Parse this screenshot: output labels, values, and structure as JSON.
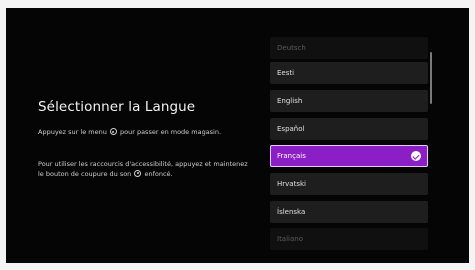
{
  "heading": "Sélectionner la Langue",
  "instructions": {
    "p1_before": "Appuyez sur le menu",
    "p1_after": "pour passer en mode magasin.",
    "p2_before": "Pour utiliser les raccourcis d'accessibilité, appuyez et maintenez le bouton de coupure du son",
    "p2_after": "enfoncé.",
    "menu_icon": "menu-button-icon",
    "mute_icon": "mute-button-icon"
  },
  "languages": [
    {
      "label": "Deutsch",
      "state": "faded"
    },
    {
      "label": "Eesti",
      "state": "normal"
    },
    {
      "label": "English",
      "state": "normal"
    },
    {
      "label": "Español",
      "state": "normal"
    },
    {
      "label": "Français",
      "state": "selected"
    },
    {
      "label": "Hrvatski",
      "state": "normal"
    },
    {
      "label": "Íslenska",
      "state": "normal"
    },
    {
      "label": "Italiano",
      "state": "faded"
    }
  ],
  "colors": {
    "background": "#050505",
    "item": "#1e1e1e",
    "selected": "#8b1ec4",
    "selected_border": "#e7c8ff"
  }
}
